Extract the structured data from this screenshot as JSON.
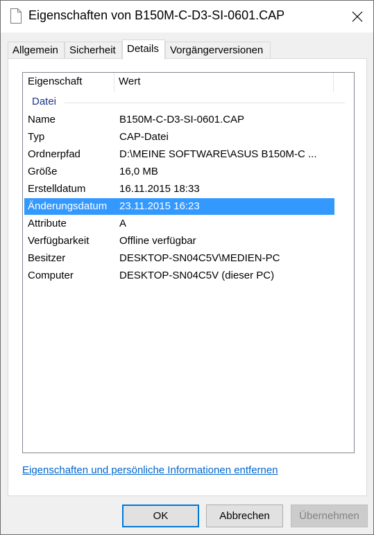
{
  "window": {
    "title": "Eigenschaften von B150M-C-D3-SI-0601.CAP"
  },
  "tabs": [
    {
      "label": "Allgemein"
    },
    {
      "label": "Sicherheit"
    },
    {
      "label": "Details"
    },
    {
      "label": "Vorgängerversionen"
    }
  ],
  "details": {
    "columns": {
      "property": "Eigenschaft",
      "value": "Wert"
    },
    "group": "Datei",
    "rows": [
      {
        "property": "Name",
        "value": "B150M-C-D3-SI-0601.CAP"
      },
      {
        "property": "Typ",
        "value": "CAP-Datei"
      },
      {
        "property": "Ordnerpfad",
        "value": "D:\\MEINE SOFTWARE\\ASUS B150M-C ..."
      },
      {
        "property": "Größe",
        "value": "16,0 MB"
      },
      {
        "property": "Erstelldatum",
        "value": "16.11.2015 18:33"
      },
      {
        "property": "Änderungsdatum",
        "value": "23.11.2015 16:23"
      },
      {
        "property": "Attribute",
        "value": "A"
      },
      {
        "property": "Verfügbarkeit",
        "value": "Offline verfügbar"
      },
      {
        "property": "Besitzer",
        "value": "DESKTOP-SN04C5V\\MEDIEN-PC"
      },
      {
        "property": "Computer",
        "value": "DESKTOP-SN04C5V (dieser PC)"
      }
    ],
    "selected_row": "Änderungsdatum"
  },
  "remove_link": "Eigenschaften und persönliche Informationen entfernen",
  "buttons": {
    "ok": "OK",
    "cancel": "Abbrechen",
    "apply": "Übernehmen"
  },
  "colors": {
    "selection": "#3399ff",
    "group_label": "#1e3287",
    "link": "#0066cc",
    "default_button_border": "#0078d7"
  },
  "icons": {
    "title": "file-icon",
    "close": "close-icon"
  }
}
